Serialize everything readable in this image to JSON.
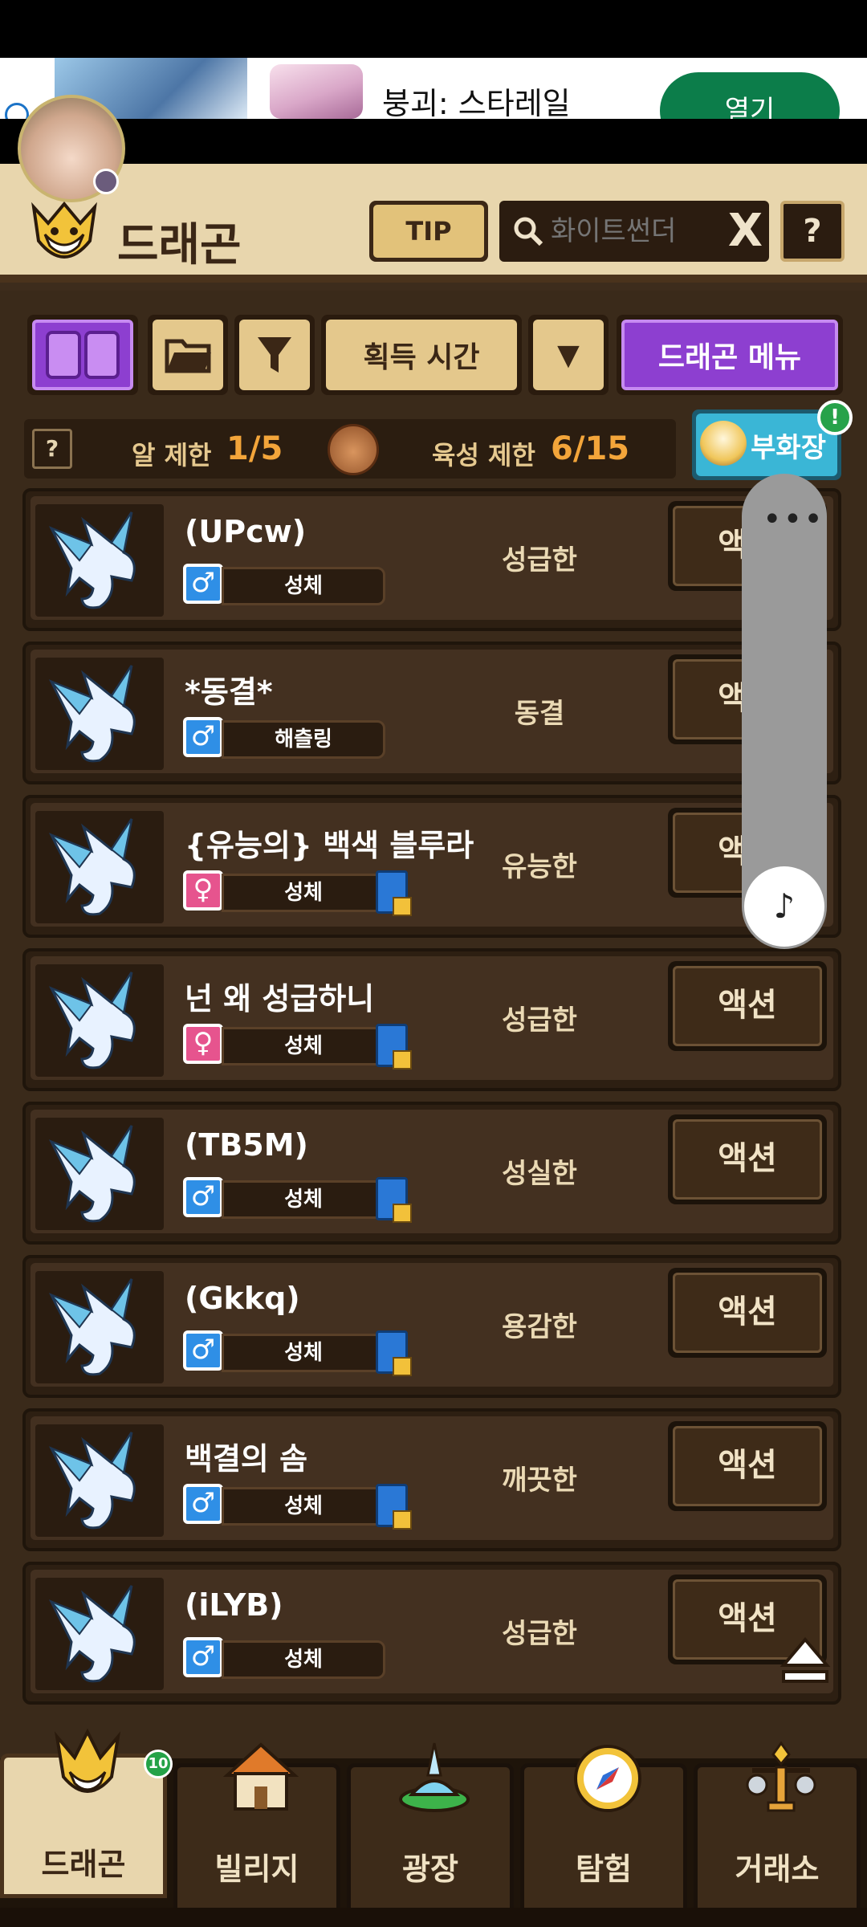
{
  "ad": {
    "title": "붕괴: 스타레일",
    "open_label": "열기"
  },
  "header": {
    "title": "드래곤",
    "tip_label": "TIP",
    "search_placeholder": "화이트썬더",
    "clear_label": "X",
    "help_label": "?"
  },
  "toolbar": {
    "sort_label": "획득 시간",
    "dropdown_label": "▼",
    "menu_label": "드래곤 메뉴"
  },
  "limits": {
    "help_label": "?",
    "egg_label": "알 제한",
    "egg_value": "1/5",
    "raise_label": "육성 제한",
    "raise_value": "6/15",
    "hatchery_label": "부화장",
    "hatchery_badge": "!"
  },
  "dragons": [
    {
      "name": "(UPcw)",
      "sex": "♂",
      "stage": "성체",
      "trait": "성급한",
      "action": "액션",
      "book": false
    },
    {
      "name": "*동결*",
      "sex": "♂",
      "stage": "해츨링",
      "trait": "동결",
      "action": "액션",
      "book": false
    },
    {
      "name": "{유능의} 백색 블루라",
      "sex": "♀",
      "stage": "성체",
      "trait": "유능한",
      "action": "액션",
      "book": true
    },
    {
      "name": "넌 왜 성급하니",
      "sex": "♀",
      "stage": "성체",
      "trait": "성급한",
      "action": "액션",
      "book": true
    },
    {
      "name": "(TB5M)",
      "sex": "♂",
      "stage": "성체",
      "trait": "성실한",
      "action": "액션",
      "book": true
    },
    {
      "name": "(Gkkq)",
      "sex": "♂",
      "stage": "성체",
      "trait": "용감한",
      "action": "액션",
      "book": true
    },
    {
      "name": "백결의 솜",
      "sex": "♂",
      "stage": "성체",
      "trait": "깨끗한",
      "action": "액션",
      "book": true
    },
    {
      "name": "(iLYB)",
      "sex": "♂",
      "stage": "성체",
      "trait": "성급한",
      "action": "액션",
      "book": false
    }
  ],
  "overlay": {
    "dots": "•••",
    "music": "♪"
  },
  "nav": {
    "items": [
      {
        "label": "드래곤",
        "count": "10"
      },
      {
        "label": "빌리지"
      },
      {
        "label": "광장"
      },
      {
        "label": "탐험"
      },
      {
        "label": "거래소"
      }
    ]
  },
  "colors": {
    "accent_purple": "#8d3fd0",
    "hatchery_cyan": "#3ab6d6",
    "value_orange": "#f3a53a",
    "male_blue": "#2f8fe6",
    "female_pink": "#e6548e"
  }
}
